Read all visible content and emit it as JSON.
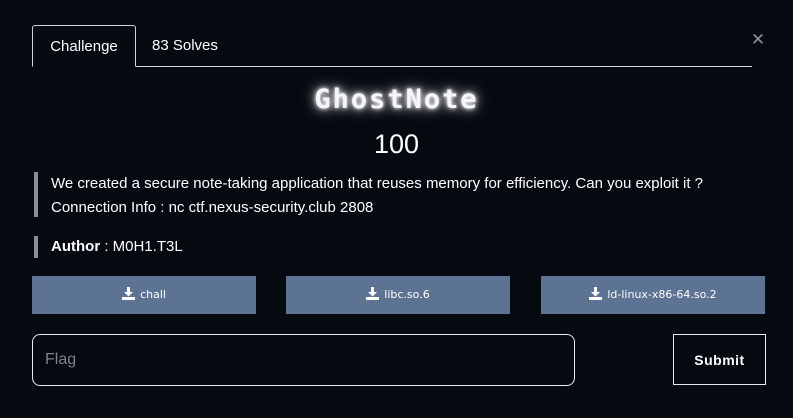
{
  "tabs": {
    "challenge_label": "Challenge",
    "solves_label": "83 Solves"
  },
  "close_icon": "close-icon",
  "challenge": {
    "name": "GhostNote",
    "points": "100",
    "description_line1": "We created a secure note-taking application that reuses memory for efficiency. Can you exploit it ?",
    "description_line2": "Connection Info : nc ctf.nexus-security.club 2808",
    "author_label": "Author",
    "author_value": " : M0H1.T3L"
  },
  "files": [
    {
      "label": "chall",
      "icon": "download-icon"
    },
    {
      "label": "libc.so.6",
      "icon": "download-icon"
    },
    {
      "label": "ld-linux-x86-64.so.2",
      "icon": "download-icon"
    }
  ],
  "flag_input": {
    "placeholder": "Flag",
    "value": ""
  },
  "submit_label": "Submit",
  "colors": {
    "background": "#050a10",
    "file_button": "#5d7393",
    "border": "#e8eaed",
    "quote_bar": "#8a8f96"
  }
}
